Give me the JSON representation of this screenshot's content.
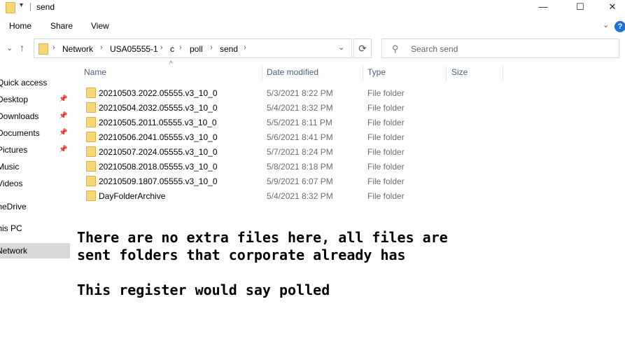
{
  "window": {
    "title": "send",
    "minimize": "—",
    "maximize": "☐",
    "close": "✕"
  },
  "ribbon": {
    "tabs": [
      "Home",
      "Share",
      "View"
    ]
  },
  "address": {
    "crumbs": [
      "Network",
      "USA05555-1",
      "c",
      "poll",
      "send"
    ]
  },
  "search": {
    "placeholder": "Search send"
  },
  "sidebar": {
    "items": [
      {
        "label": "Quick access",
        "pinned": false
      },
      {
        "label": "Desktop",
        "pinned": true
      },
      {
        "label": "Downloads",
        "pinned": true
      },
      {
        "label": "Documents",
        "pinned": true
      },
      {
        "label": "Pictures",
        "pinned": true
      },
      {
        "label": "Music",
        "pinned": false
      },
      {
        "label": "Videos",
        "pinned": false
      },
      {
        "label": "OneDrive",
        "pinned": false
      },
      {
        "label": "This PC",
        "pinned": false
      },
      {
        "label": "Network",
        "pinned": false,
        "selected": true
      }
    ]
  },
  "columns": {
    "name": "Name",
    "date": "Date modified",
    "type": "Type",
    "size": "Size"
  },
  "files": [
    {
      "name": "20210503.2022.05555.v3_10_0",
      "date": "5/3/2021 8:22 PM",
      "type": "File folder"
    },
    {
      "name": "20210504.2032.05555.v3_10_0",
      "date": "5/4/2021 8:32 PM",
      "type": "File folder"
    },
    {
      "name": "20210505.2011.05555.v3_10_0",
      "date": "5/5/2021 8:11 PM",
      "type": "File folder"
    },
    {
      "name": "20210506.2041.05555.v3_10_0",
      "date": "5/6/2021 8:41 PM",
      "type": "File folder"
    },
    {
      "name": "20210507.2024.05555.v3_10_0",
      "date": "5/7/2021 8:24 PM",
      "type": "File folder"
    },
    {
      "name": "20210508.2018.05555.v3_10_0",
      "date": "5/8/2021 8:18 PM",
      "type": "File folder"
    },
    {
      "name": "20210509.1807.05555.v3_10_0",
      "date": "5/9/2021 6:07 PM",
      "type": "File folder"
    },
    {
      "name": "DayFolderArchive",
      "date": "5/4/2021 8:32 PM",
      "type": "File folder"
    }
  ],
  "annotation": {
    "line1": "There are no extra files here, all files are",
    "line2": "sent folders that corporate already has",
    "line3": "This register would say polled"
  }
}
